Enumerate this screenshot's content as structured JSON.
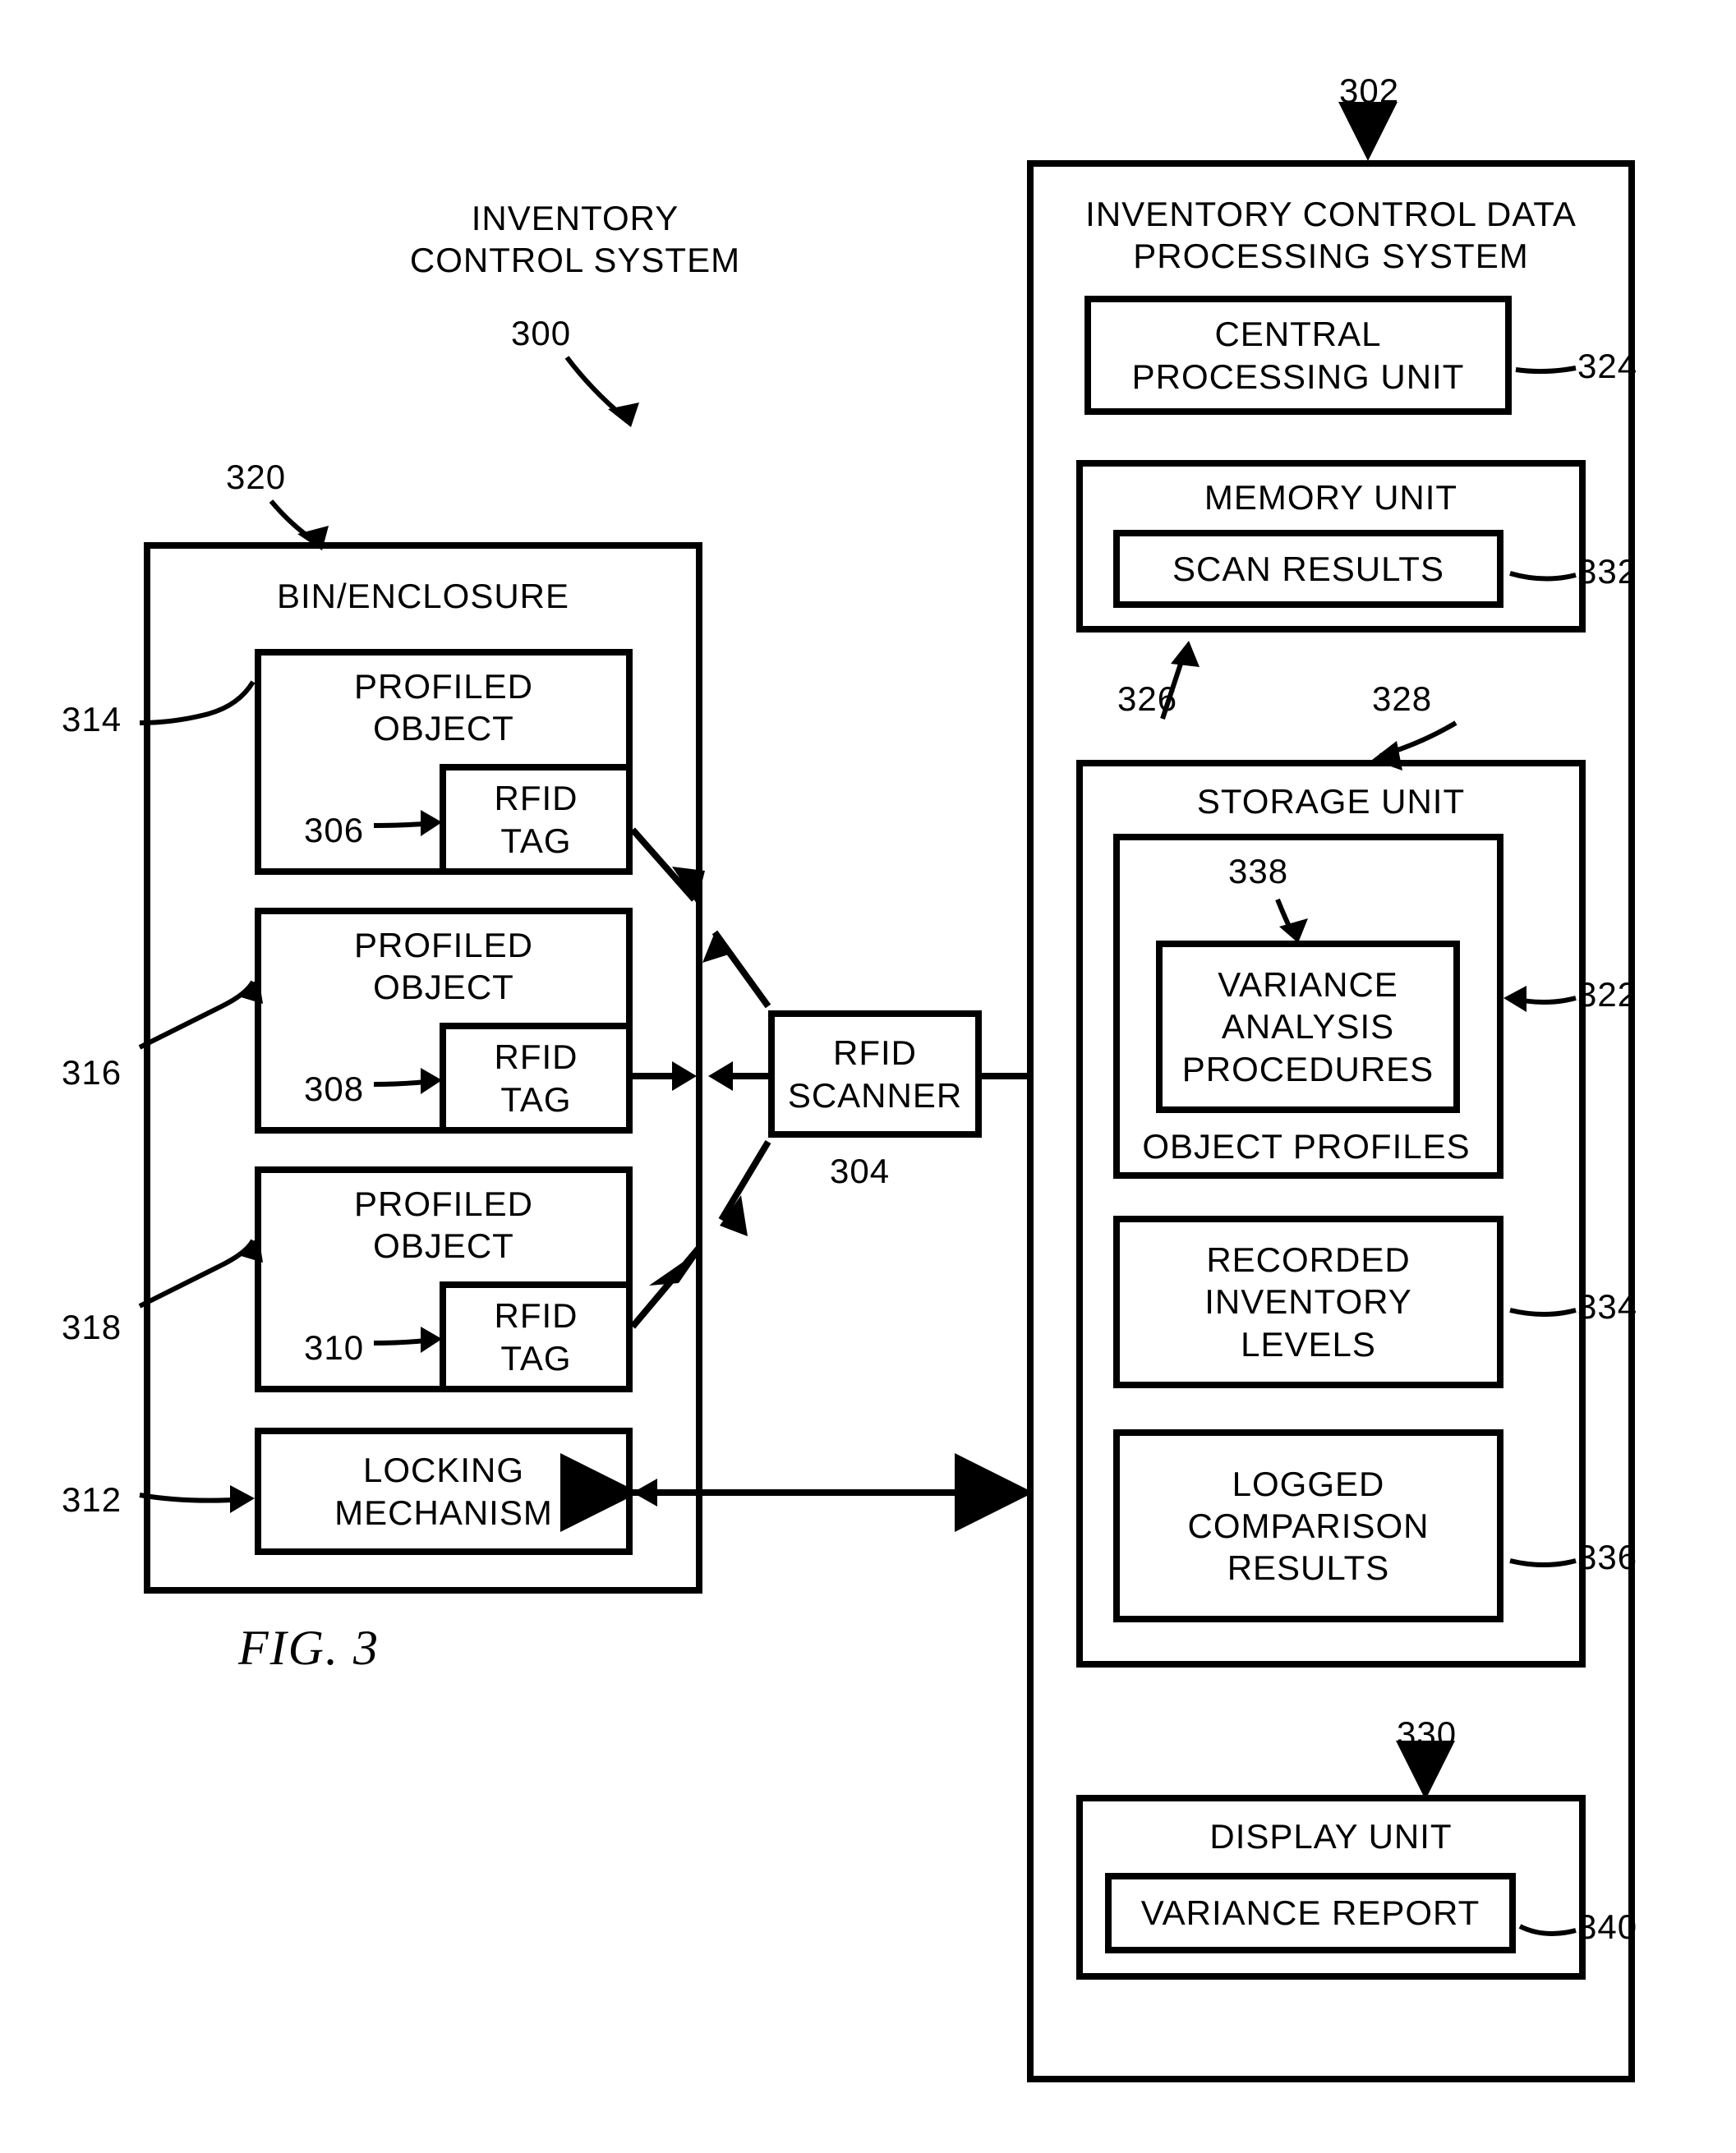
{
  "fig_label": "FIG. 3",
  "system_title": "INVENTORY\nCONTROL SYSTEM",
  "idps_title": "INVENTORY CONTROL DATA\nPROCESSING SYSTEM",
  "bin_title": "BIN/ENCLOSURE",
  "profiled_object": "PROFILED\nOBJECT",
  "rfid_tag": "RFID\nTAG",
  "locking_mechanism": "LOCKING\nMECHANISM",
  "rfid_scanner": "RFID\nSCANNER",
  "cpu": "CENTRAL\nPROCESSING UNIT",
  "memory_unit_title": "MEMORY UNIT",
  "scan_results": "SCAN RESULTS",
  "storage_unit_title": "STORAGE UNIT",
  "variance_analysis": "VARIANCE\nANALYSIS\nPROCEDURES",
  "object_profiles": "OBJECT PROFILES",
  "recorded_inventory": "RECORDED\nINVENTORY\nLEVELS",
  "logged_comparison": "LOGGED\nCOMPARISON\nRESULTS",
  "display_unit_title": "DISPLAY UNIT",
  "variance_report": "VARIANCE REPORT",
  "n": {
    "300": "300",
    "302": "302",
    "304": "304",
    "306": "306",
    "308": "308",
    "310": "310",
    "312": "312",
    "314": "314",
    "316": "316",
    "318": "318",
    "320": "320",
    "322": "322",
    "324": "324",
    "326": "326",
    "328": "328",
    "330": "330",
    "332": "332",
    "334": "334",
    "336": "336",
    "338": "338",
    "340": "340"
  }
}
